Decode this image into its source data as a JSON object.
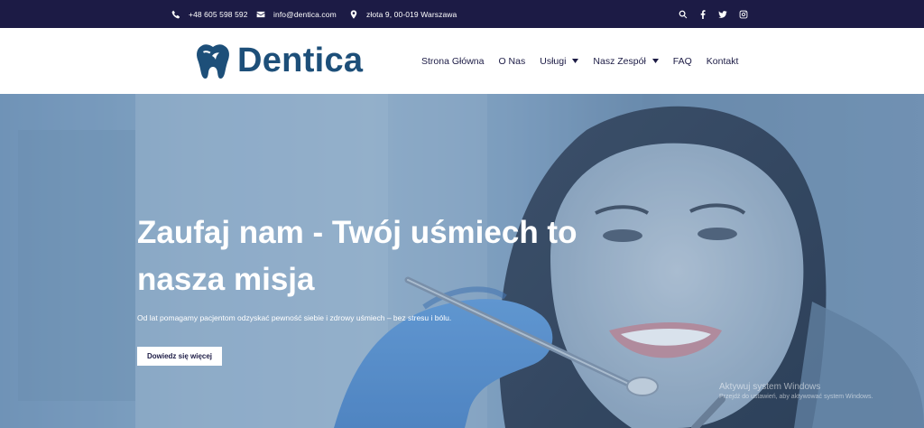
{
  "topbar": {
    "phone": "+48 605 598 592",
    "email": "info@dentica.com",
    "address": "złota 9, 00-019 Warszawa",
    "icons": [
      "phone-icon",
      "envelope-icon",
      "map-pin-icon",
      "search-icon",
      "facebook-icon",
      "twitter-icon",
      "instagram-icon"
    ]
  },
  "header": {
    "logo_text": "Dentica",
    "nav": [
      {
        "label": "Strona Główna",
        "dropdown": false
      },
      {
        "label": "O Nas",
        "dropdown": false
      },
      {
        "label": "Usługi",
        "dropdown": true
      },
      {
        "label": "Nasz Zespół",
        "dropdown": true
      },
      {
        "label": "FAQ",
        "dropdown": false
      },
      {
        "label": "Kontakt",
        "dropdown": false
      }
    ]
  },
  "hero": {
    "title": "Zaufaj nam - Twój uśmiech to nasza misja",
    "subtitle": "Od lat pomagamy pacjentom odzyskać pewność siebie i zdrowy uśmiech – bez stresu i bólu.",
    "button_label": "Dowiedz się więcej"
  },
  "watermark": {
    "line1": "Aktywuj system Windows",
    "line2": "Przejdź do ustawień, aby aktywować system Windows."
  },
  "colors": {
    "topbar_bg": "#1c1b45",
    "brand": "#1d4f79",
    "hero_overlay": "#7c9dbf"
  }
}
